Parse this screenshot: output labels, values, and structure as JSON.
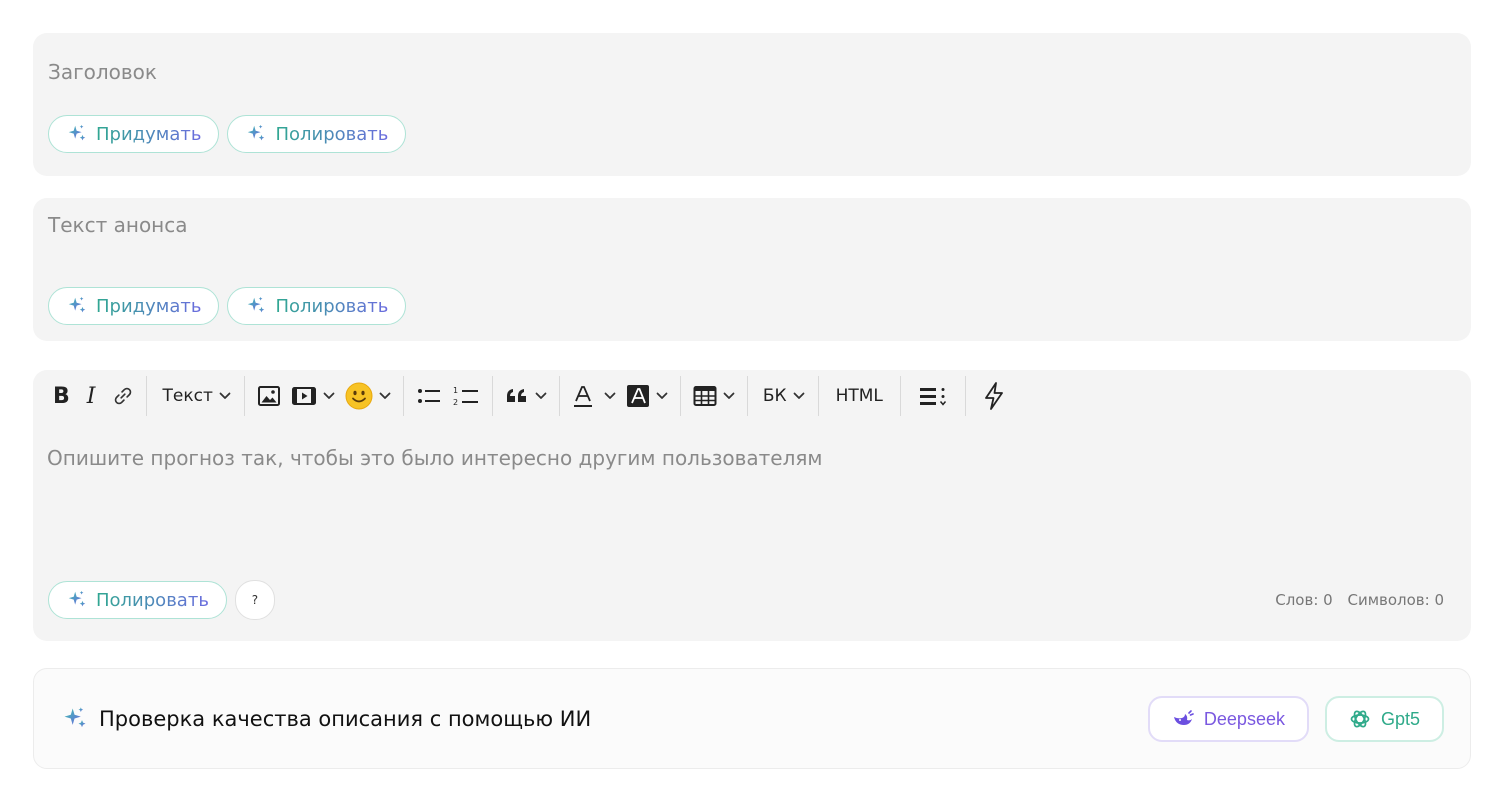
{
  "title_field": {
    "placeholder": "Заголовок",
    "buttons": {
      "invent": "Придумать",
      "polish": "Полировать"
    }
  },
  "lead_field": {
    "placeholder": "Текст анонса",
    "buttons": {
      "invent": "Придумать",
      "polish": "Полировать"
    }
  },
  "editor": {
    "toolbar": {
      "bold": "B",
      "italic": "I",
      "text_style": "Текст",
      "bk": "БК",
      "html": "HTML"
    },
    "placeholder": "Опишите прогноз так, чтобы это было интересно другим пользователям",
    "polish_button": "Полировать",
    "help": "?",
    "words": "Слов: 0",
    "chars": "Символов: 0"
  },
  "quality_check": {
    "label": "Проверка качества описания с помощью ИИ",
    "models": {
      "deepseek": "Deepseek",
      "gpt": "Gpt5"
    }
  },
  "colors": {
    "card_bg": "#f4f4f4",
    "teal": "#2f9e8f",
    "purple": "#7a58e0",
    "placeholder": "#8a8a8a"
  }
}
